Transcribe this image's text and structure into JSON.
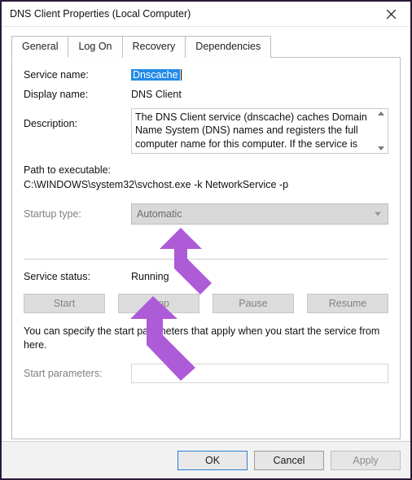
{
  "titlebar": {
    "title": "DNS Client Properties (Local Computer)"
  },
  "tabs": {
    "general": "General",
    "logon": "Log On",
    "recovery": "Recovery",
    "dependencies": "Dependencies"
  },
  "labels": {
    "service_name": "Service name:",
    "display_name": "Display name:",
    "description": "Description:",
    "path_label": "Path to executable:",
    "startup_type": "Startup type:",
    "service_status": "Service status:",
    "start_params": "Start parameters:"
  },
  "values": {
    "service_name": "Dnscache",
    "display_name": "DNS Client",
    "description": "The DNS Client service (dnscache) caches Domain Name System (DNS) names and registers the full computer name for this computer. If the service is",
    "path": "C:\\WINDOWS\\system32\\svchost.exe -k NetworkService -p",
    "startup_type": "Automatic",
    "service_status": "Running",
    "start_params": ""
  },
  "buttons": {
    "start": "Start",
    "stop": "Stop",
    "pause": "Pause",
    "resume": "Resume",
    "ok": "OK",
    "cancel": "Cancel",
    "apply": "Apply"
  },
  "note": "You can specify the start parameters that apply when you start the service from here.",
  "annotation_color": "#ae5bd8"
}
